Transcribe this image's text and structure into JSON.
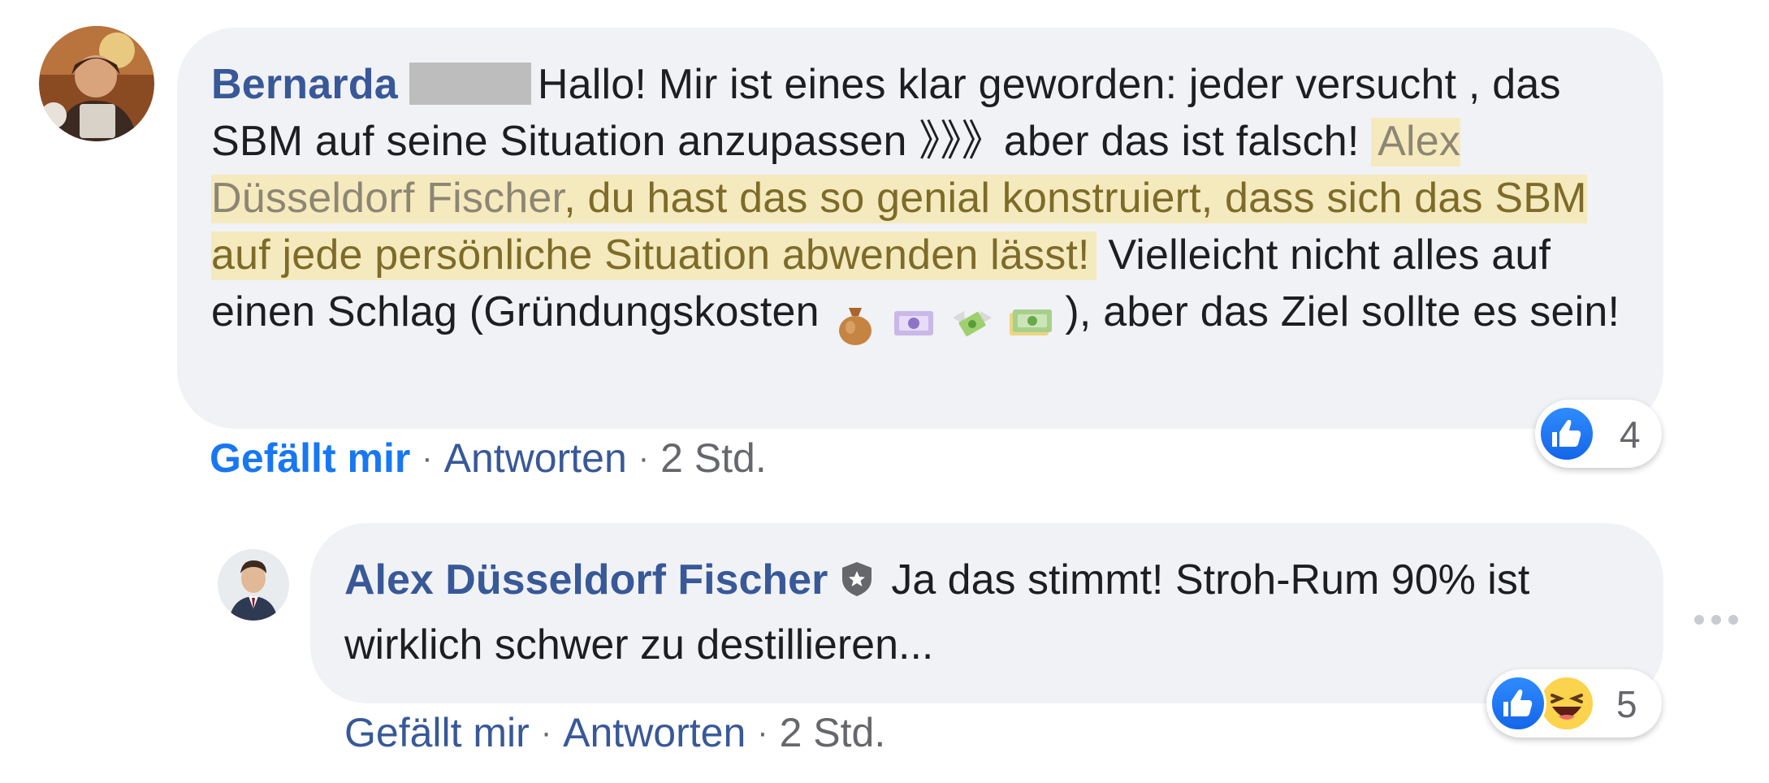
{
  "comment": {
    "author": "Bernarda",
    "text_part1": "Hallo! Mir ist eines klar geworden: jeder versucht , das SBM auf seine Situation anzupassen 》》》aber das ist falsch! ",
    "mention": "Alex Düsseldorf Fischer",
    "highlight_rest": ", du hast das so genial konstruiert, dass sich das SBM auf jede persönliche Situation abwenden lässt!",
    "text_part2": " Vielleicht nicht alles auf einen Schlag (Gründungskosten ",
    "emoji_icons": [
      "money-bag-icon",
      "euro-banknote-icon",
      "money-with-wings-icon",
      "banknotes-icon"
    ],
    "text_part3": "), aber das Ziel sollte es sein!",
    "reaction_count": "4",
    "actions": {
      "like": "Gefällt mir",
      "reply": "Antworten",
      "time": "2 Std.",
      "separator": "·"
    }
  },
  "reply": {
    "author": "Alex Düsseldorf Fischer",
    "text": "Ja das stimmt! Stroh-Rum 90% ist wirklich schwer zu destillieren...",
    "reaction_count": "5",
    "actions": {
      "like": "Gefällt mir",
      "reply": "Antworten",
      "time": "2 Std.",
      "separator": "·"
    }
  },
  "colors": {
    "bubble": "#f0f2f5",
    "author": "#385898",
    "like_active": "#1877f2",
    "highlight_bg": "#f5eabd",
    "highlight_text": "#7d6b2a",
    "muted": "#65676b"
  }
}
